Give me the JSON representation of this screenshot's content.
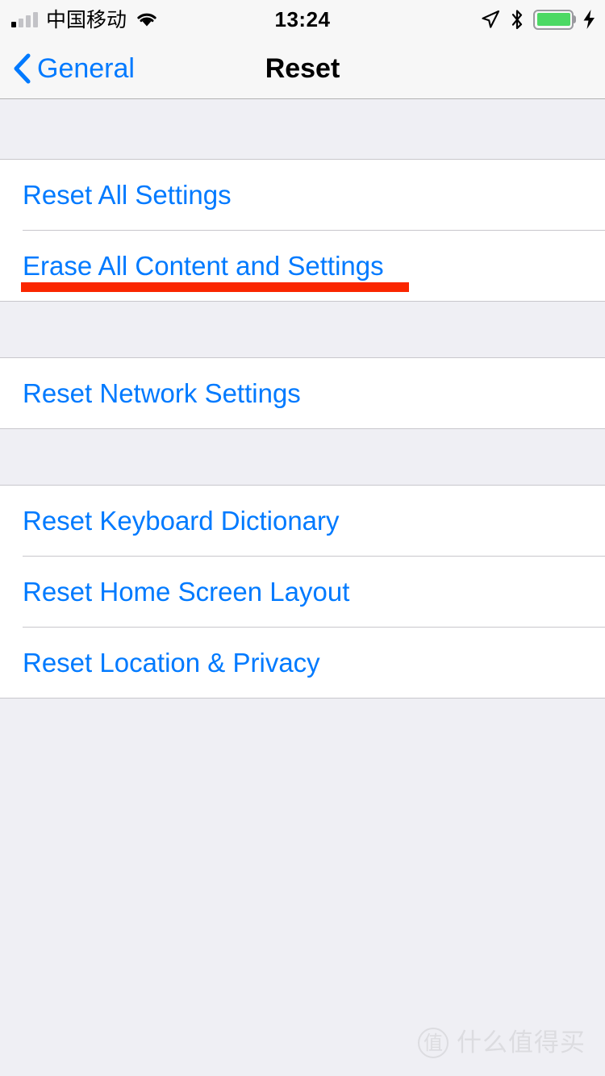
{
  "status_bar": {
    "carrier": "中国移动",
    "time": "13:24",
    "signal_strength": 1,
    "signal_total": 4,
    "icons": {
      "wifi": "wifi-icon",
      "location": "location-arrow-icon",
      "bluetooth": "bluetooth-icon",
      "battery": "battery-full-icon",
      "charging": "lightning-bolt-icon"
    },
    "battery_color": "#4CD964",
    "battery_level": 100
  },
  "nav_bar": {
    "back_label": "General",
    "back_icon": "chevron-left-icon",
    "title": "Reset",
    "tint_color": "#007AFF"
  },
  "groups": [
    {
      "rows": [
        {
          "label": "Reset All Settings",
          "annotated": false
        },
        {
          "label": "Erase All Content and Settings",
          "annotated": true
        }
      ]
    },
    {
      "rows": [
        {
          "label": "Reset Network Settings",
          "annotated": false
        }
      ]
    },
    {
      "rows": [
        {
          "label": "Reset Keyboard Dictionary",
          "annotated": false
        },
        {
          "label": "Reset Home Screen Layout",
          "annotated": false
        },
        {
          "label": "Reset Location & Privacy",
          "annotated": false
        }
      ]
    }
  ],
  "annotation": {
    "color": "#FA2600",
    "target": "Erase All Content and Settings"
  },
  "watermark": {
    "logo_glyph": "值",
    "text": "什么值得买",
    "color": "#DCDCE0"
  },
  "theme": {
    "background": "#EFEFF4",
    "row_background": "#FFFFFF",
    "separator": "#C8C7CC",
    "bar_background": "#F7F7F7",
    "link_blue": "#007AFF"
  }
}
